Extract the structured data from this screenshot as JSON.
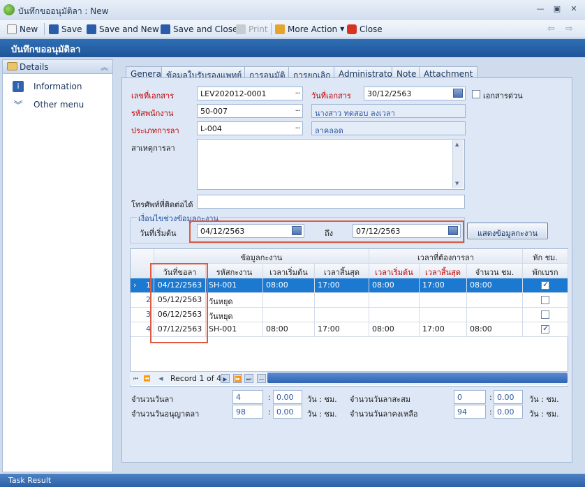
{
  "window": {
    "title": "บันทึกขออนุมัติลา : New"
  },
  "toolbar": {
    "new": "New",
    "save": "Save",
    "save_and_new": "Save and New",
    "save_and_close": "Save and Close",
    "print": "Print",
    "more_action": "More Action",
    "close": "Close"
  },
  "header": {
    "title": "บันทึกขออนุมัติลา"
  },
  "sidebar": {
    "section": "Details",
    "items": [
      {
        "label": "Information"
      },
      {
        "label": "Other menu"
      }
    ]
  },
  "tabs": [
    "General",
    "ข้อมูลใบรับรองแพทย์",
    "การอนุมัติ",
    "การยกเลิก",
    "Administrator",
    "Note",
    "Attachment"
  ],
  "form": {
    "doc_no_label": "เลขที่เอกสาร",
    "doc_no": "LEV202012-0001",
    "doc_date_label": "วันที่เอกสาร",
    "doc_date": "30/12/2563",
    "urgent_label": "เอกสารด่วน",
    "emp_code_label": "รหัสพนักงาน",
    "emp_code": "50-007",
    "emp_name": "นางสาว ทดสอบ ลงเวลา",
    "leave_type_label": "ประเภทการลา",
    "leave_type": "L-004",
    "leave_type_name": "ลาคลอด",
    "reason_label": "สาเหตุการลา",
    "reason": "",
    "phone_label": "โทรศัพท์ที่ติดต่อได้",
    "phone": "",
    "group_label": "เงื่อนไขช่วงข้อมูลกะงาน",
    "start_label": "วันที่เริ่มต้น",
    "start_date": "04/12/2563",
    "to_label": "ถึง",
    "end_date": "07/12/2563",
    "show_button": "แสดงข้อมูลกะงาน"
  },
  "grid": {
    "band_shift": "ข้อมูลกะงาน",
    "band_time": "เวลาที่ต้องการลา",
    "band_break": "หัก ชม.",
    "columns": [
      "วันที่ขอลา",
      "รหัสกะงาน",
      "เวลาเริ่มต้น",
      "เวลาสิ้นสุด",
      "เวลาเริ่มต้น",
      "เวลาสิ้นสุด",
      "จำนวน ชม.",
      "พักเบรก"
    ],
    "rows": [
      {
        "no": "1",
        "date": "04/12/2563",
        "shift": "SH-001",
        "s_start": "08:00",
        "s_end": "17:00",
        "l_start": "08:00",
        "l_end": "17:00",
        "hours": "08:00",
        "brk": true,
        "selected": true
      },
      {
        "no": "2",
        "date": "05/12/2563",
        "shift": "วันหยุด",
        "s_start": "",
        "s_end": "",
        "l_start": "",
        "l_end": "",
        "hours": "",
        "brk": false
      },
      {
        "no": "3",
        "date": "06/12/2563",
        "shift": "วันหยุด",
        "s_start": "",
        "s_end": "",
        "l_start": "",
        "l_end": "",
        "hours": "",
        "brk": false
      },
      {
        "no": "4",
        "date": "07/12/2563",
        "shift": "SH-001",
        "s_start": "08:00",
        "s_end": "17:00",
        "l_start": "08:00",
        "l_end": "17:00",
        "hours": "08:00",
        "brk": true
      }
    ],
    "record_text": "Record 1 of 4"
  },
  "summary": {
    "leave_days_label": "จำนวนวันลา",
    "leave_days": "4",
    "leave_hours": "0.00",
    "accum_label": "จำนวนวันลาสะสม",
    "accum_days": "0",
    "accum_hours": "0.00",
    "allowed_label": "จำนวนวันอนุญาตลา",
    "allowed_days": "98",
    "allowed_hours": "0.00",
    "remain_label": "จำนวนวันลาคงเหลือ",
    "remain_days": "94",
    "remain_hours": "0.00",
    "unit": "วัน : ชม.",
    "colon": ":"
  },
  "status": {
    "task_result": "Task Result"
  },
  "colors": {
    "header": "#1f5598",
    "selected_row": "#1c79d1",
    "required_label": "#c00000",
    "highlight_box": "#e2583e"
  }
}
